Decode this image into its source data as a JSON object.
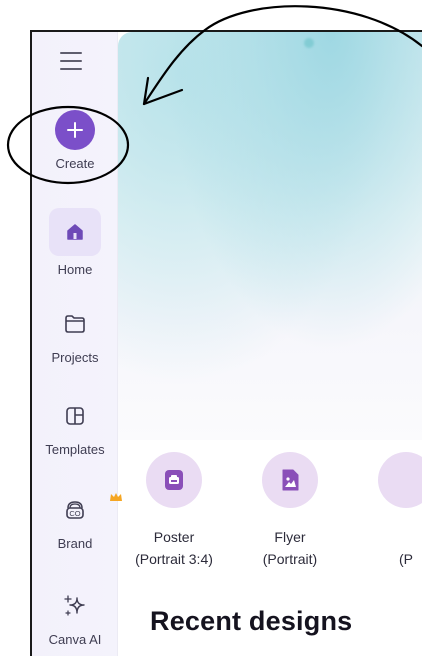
{
  "sidebar": {
    "items": [
      {
        "label": "Create"
      },
      {
        "label": "Home"
      },
      {
        "label": "Projects"
      },
      {
        "label": "Templates"
      },
      {
        "label": "Brand"
      },
      {
        "label": "Canva AI"
      }
    ]
  },
  "quick_create": [
    {
      "label": "Poster",
      "sublabel": "(Portrait 3:4)"
    },
    {
      "label": "Flyer",
      "sublabel": "(Portrait)"
    },
    {
      "label": "",
      "sublabel": "(P"
    }
  ],
  "recent": {
    "title": "Recent designs"
  },
  "colors": {
    "accent": "#7b4fc9",
    "rail_background": "#f3f1fb",
    "quick_circle": "#eadcf3"
  },
  "icons": [
    "menu-icon",
    "plus-icon",
    "home-icon",
    "folder-icon",
    "templates-icon",
    "brand-icon",
    "crown-icon",
    "sparkles-icon",
    "poster-icon",
    "flyer-icon"
  ]
}
